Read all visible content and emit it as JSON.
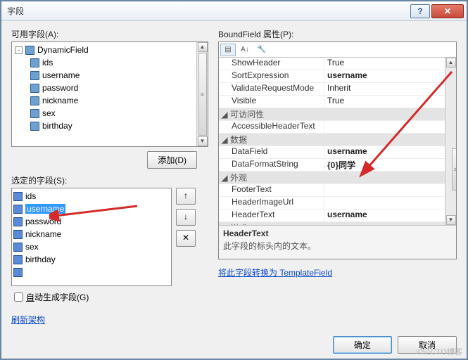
{
  "window": {
    "title": "字段"
  },
  "labels": {
    "available": "可用字段(A):",
    "add": "添加(D)",
    "selected": "选定的字段(S):",
    "bound": "BoundField 属性(P):",
    "autogen": "自动生成字段(G)",
    "refresh": "刷新架构",
    "convert": "将此字段转换为 TemplateField",
    "ok": "确定",
    "cancel": "取消"
  },
  "tree": {
    "root": "DynamicField",
    "children": [
      "ids",
      "username",
      "password",
      "nickname",
      "sex",
      "birthday"
    ]
  },
  "selectedList": [
    "ids",
    "username",
    "password",
    "nickname",
    "sex",
    "birthday",
    "..."
  ],
  "selectedIndex": 1,
  "propCategories": {
    "c0": {
      "name": "",
      "rows": [
        {
          "n": "ShowHeader",
          "v": "True"
        },
        {
          "n": "SortExpression",
          "v": "username",
          "bold": true
        },
        {
          "n": "ValidateRequestMode",
          "v": "Inherit"
        },
        {
          "n": "Visible",
          "v": "True"
        }
      ]
    },
    "c1": {
      "name": "可访问性",
      "rows": [
        {
          "n": "AccessibleHeaderText",
          "v": ""
        }
      ]
    },
    "c2": {
      "name": "数据",
      "rows": [
        {
          "n": "DataField",
          "v": "username",
          "bold": true
        },
        {
          "n": "DataFormatString",
          "v": "{0}同学",
          "bold": true
        }
      ]
    },
    "c3": {
      "name": "外观",
      "rows": [
        {
          "n": "FooterText",
          "v": ""
        },
        {
          "n": "HeaderImageUrl",
          "v": ""
        },
        {
          "n": "HeaderText",
          "v": "username",
          "bold": true
        }
      ]
    },
    "c4": {
      "name": "样式"
    }
  },
  "desc": {
    "name": "HeaderText",
    "text": "此字段的标头内的文本。"
  },
  "watermark": "©51CTO博客"
}
